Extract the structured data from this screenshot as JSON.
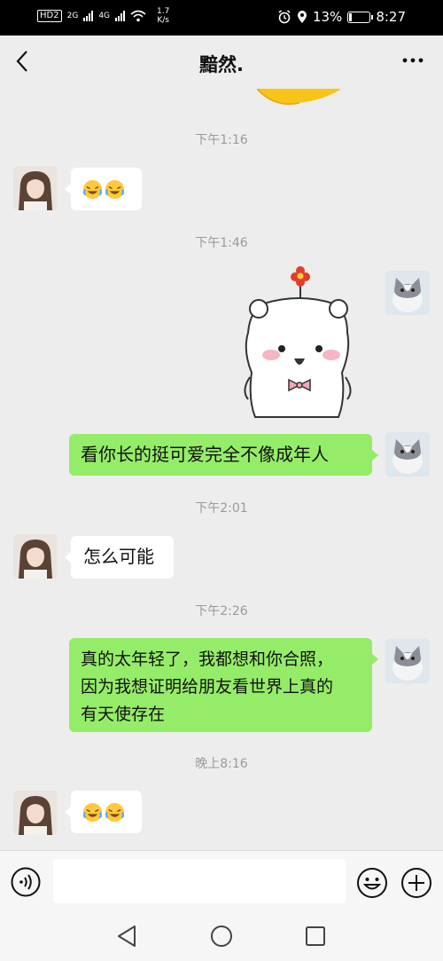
{
  "status_bar": {
    "left_tag": "HD",
    "left_tag_num": "2",
    "signal1": "2G",
    "signal2": "4G",
    "speed_value": "1.7",
    "speed_unit": "K/s",
    "battery": "13%",
    "battery_level": 0.13,
    "time": "8:27"
  },
  "header": {
    "title": "黯然.",
    "back_icon": "chevron-left-icon",
    "more_icon": "more-dots-icon"
  },
  "messages": [
    {
      "type": "time",
      "text": "下午1:16"
    },
    {
      "type": "incoming_emoji",
      "text": ""
    },
    {
      "type": "time",
      "text": "下午1:46"
    },
    {
      "type": "outgoing_sticker",
      "text": ""
    },
    {
      "type": "outgoing",
      "text": "看你长的挺可爱完全不像成年人"
    },
    {
      "type": "time",
      "text": "下午2:01"
    },
    {
      "type": "incoming",
      "text": "怎么可能"
    },
    {
      "type": "time",
      "text": "下午2:26"
    },
    {
      "type": "outgoing",
      "lines": [
        "真的太年轻了，我都想和你合照，",
        "因为我想证明给朋友看世界上真的",
        "有天使存在"
      ]
    },
    {
      "type": "time",
      "text": "晚上8:16"
    },
    {
      "type": "incoming_emoji",
      "text": ""
    }
  ],
  "input_bar": {
    "value": "",
    "voice_icon": "voice-icon",
    "emoji_icon": "emoji-icon",
    "plus_icon": "plus-icon"
  },
  "colors": {
    "background": "#ededed",
    "outgoing_bubble": "#95ec69",
    "incoming_bubble": "#ffffff",
    "timestamp": "#9a9a9a"
  }
}
